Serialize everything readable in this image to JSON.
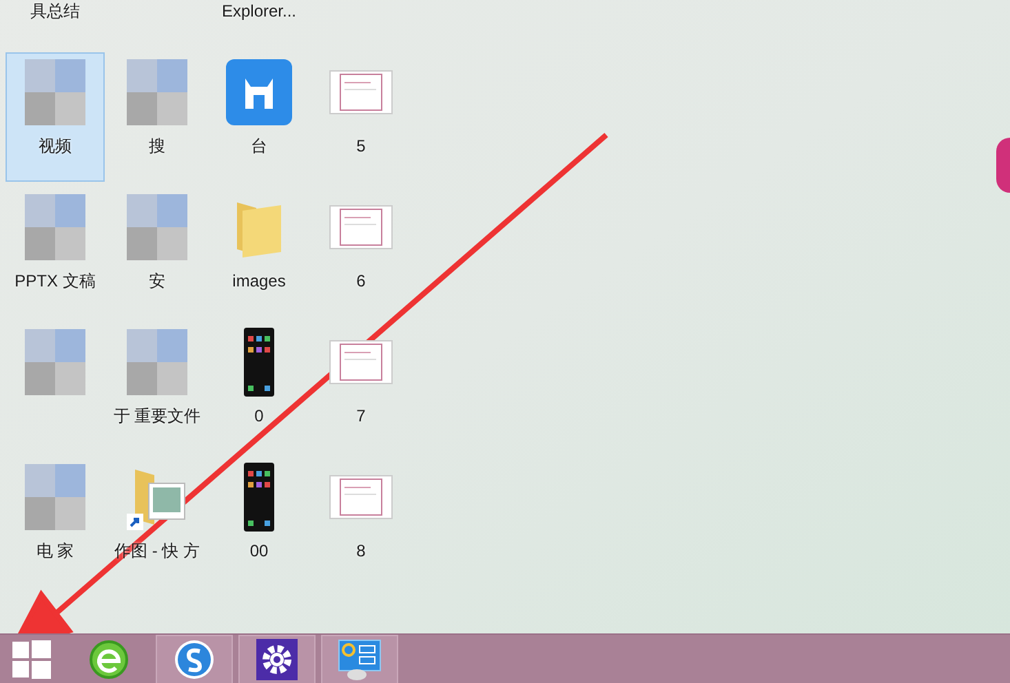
{
  "desktop": {
    "icons": [
      {
        "kind": "hidden",
        "label": "具总结",
        "selected": false
      },
      {
        "kind": "hidden"
      },
      {
        "kind": "hidden",
        "label": "Explorer...",
        "selected": false
      },
      {
        "kind": "hidden"
      },
      {
        "kind": "obscured",
        "label": "视频",
        "selected": true
      },
      {
        "kind": "obscured",
        "label": "搜",
        "selected": false
      },
      {
        "kind": "app",
        "label": "台",
        "selected": false
      },
      {
        "kind": "thumbnail",
        "label": "5",
        "selected": false
      },
      {
        "kind": "obscured",
        "label": "PPTX 文稿",
        "selected": false
      },
      {
        "kind": "obscured",
        "label": "安",
        "selected": false
      },
      {
        "kind": "folder",
        "label": "images",
        "selected": false
      },
      {
        "kind": "thumbnail",
        "label": "6",
        "selected": false
      },
      {
        "kind": "obscured",
        "selected": false
      },
      {
        "kind": "obscured",
        "label": "于 重要文件",
        "selected": false
      },
      {
        "kind": "phone",
        "label": "0",
        "selected": false
      },
      {
        "kind": "thumbnail",
        "label": "7",
        "selected": false
      },
      {
        "kind": "obscured",
        "label": "电 家",
        "selected": false
      },
      {
        "kind": "shortcut-folder",
        "label": "作图 - 快 方",
        "selected": false
      },
      {
        "kind": "phone",
        "label": "00",
        "selected": false
      },
      {
        "kind": "thumbnail",
        "label": "8",
        "selected": false
      }
    ]
  },
  "taskbar": {
    "items": [
      {
        "kind": "start",
        "running": false
      },
      {
        "kind": "browser",
        "running": false
      },
      {
        "kind": "sogou",
        "running": true
      },
      {
        "kind": "settings",
        "running": true
      },
      {
        "kind": "control-panel",
        "running": true
      }
    ]
  }
}
